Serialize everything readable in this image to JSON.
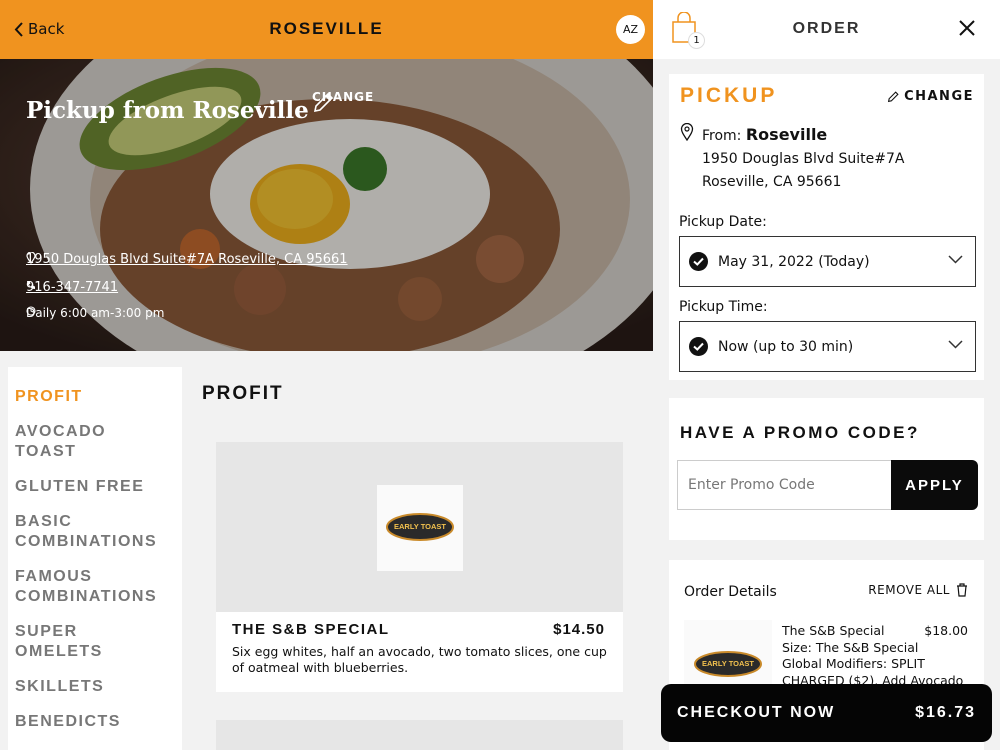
{
  "header": {
    "back_label": "Back",
    "location_title": "ROSEVILLE",
    "avatar_initials": "AZ"
  },
  "hero": {
    "title": "Pickup from Roseville",
    "change_label": "CHANGE",
    "address": "1950 Douglas Blvd Suite#7A Roseville, CA 95661",
    "phone": "916-347-7741",
    "hours": "Daily 6:00 am-3:00 pm"
  },
  "menu": {
    "categories": [
      {
        "label": "PROFIT",
        "active": true
      },
      {
        "label": "AVOCADO TOAST"
      },
      {
        "label": "GLUTEN FREE"
      },
      {
        "label": "BASIC COMBINATIONS"
      },
      {
        "label": "FAMOUS COMBINATIONS"
      },
      {
        "label": "SUPER OMELETS"
      },
      {
        "label": "SKILLETS"
      },
      {
        "label": "BENEDICTS"
      }
    ],
    "section_title": "PROFIT",
    "items": [
      {
        "name": "THE S&B SPECIAL",
        "price": "$14.50",
        "description": "Six egg whites, half an avocado, two tomato slices, one cup of oatmeal with blueberries."
      }
    ]
  },
  "logo_text": "EARLY TOAST",
  "order": {
    "title": "ORDER",
    "bag_count": "1",
    "pickup": {
      "title": "PICKUP",
      "change_label": "CHANGE",
      "from_prefix": "From:",
      "from_name": "Roseville",
      "address_line1": "1950 Douglas Blvd Suite#7A",
      "address_line2": "Roseville, CA 95661",
      "date_label": "Pickup Date:",
      "date_value": "May 31, 2022 (Today)",
      "time_label": "Pickup Time:",
      "time_value": "Now (up to 30 min)"
    },
    "promo": {
      "title": "HAVE A PROMO CODE?",
      "placeholder": "Enter Promo Code",
      "apply_label": "APPLY"
    },
    "details": {
      "title": "Order Details",
      "remove_all_label": "REMOVE ALL",
      "item_name": "The S&B Special",
      "item_price": "$18.00",
      "item_size": "Size: The S&B Special",
      "item_modifiers": "Global Modifiers: SPLIT CHARGED ($2), Add Avocado"
    },
    "checkout_label": "CHECKOUT NOW",
    "checkout_total": "$16.73"
  },
  "colors": {
    "accent": "#f0931f",
    "dark": "#050505"
  },
  "icons": [
    "chevron-left-icon",
    "pencil-icon",
    "map-pin-icon",
    "phone-icon",
    "clock-icon",
    "bag-icon",
    "close-icon",
    "check-circle-icon",
    "chevron-down-icon",
    "trash-icon"
  ]
}
